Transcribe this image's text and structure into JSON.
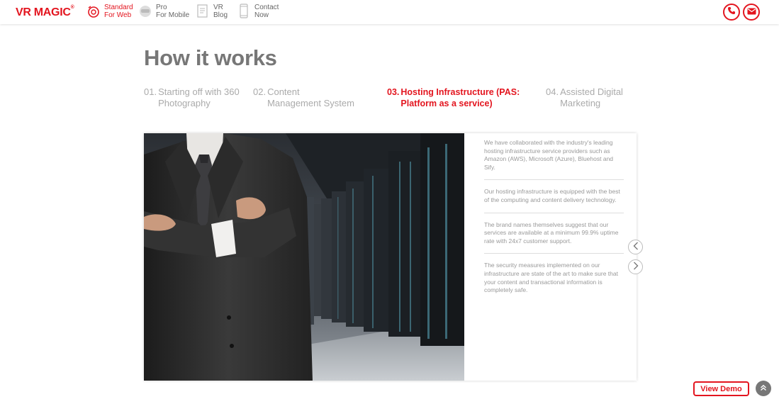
{
  "header": {
    "logo": "VR MAGIC",
    "logo_mark": "®",
    "nav": [
      {
        "line1": "Standard",
        "line2": "For Web",
        "icon": "camera-360-icon",
        "active": true
      },
      {
        "line1": "Pro",
        "line2": "For Mobile",
        "icon": "vr-headset-icon",
        "active": false
      },
      {
        "line1": "VR",
        "line2": "Blog",
        "icon": "blog-document-icon",
        "active": false
      },
      {
        "line1": "Contact",
        "line2": "Now",
        "icon": "mobile-phone-icon",
        "active": false
      }
    ],
    "actions": [
      "phone-icon",
      "email-icon"
    ]
  },
  "main": {
    "title": "How it works",
    "tabs": [
      {
        "num": "01.",
        "label": "Starting off with 360 Photography",
        "active": false
      },
      {
        "num": "02.",
        "label": "Content Management System",
        "active": false
      },
      {
        "num": "03.",
        "label": "Hosting Infrastructure (PAS: Platform as a service)",
        "active": true
      },
      {
        "num": "04.",
        "label": "Assisted Digital Marketing",
        "active": false
      }
    ],
    "paragraphs": [
      "We have collaborated with the industry's leading hosting infrastructure service providers such as Amazon (AWS), Microsoft (Azure), Bluehost and Sify.",
      "Our hosting infrastructure is equipped with the best of the computing and content delivery technology.",
      "The brand names themselves suggest that our services are available at a minimum 99.9% uptime rate with 24x7 customer support.",
      "The security measures implemented on our infrastructure are state of the art to make sure that your content and transactional information is completely safe."
    ]
  },
  "footer": {
    "demo_label": "View Demo"
  },
  "colors": {
    "accent": "#e3151f",
    "title": "#777777",
    "muted": "#aaaaaa"
  }
}
